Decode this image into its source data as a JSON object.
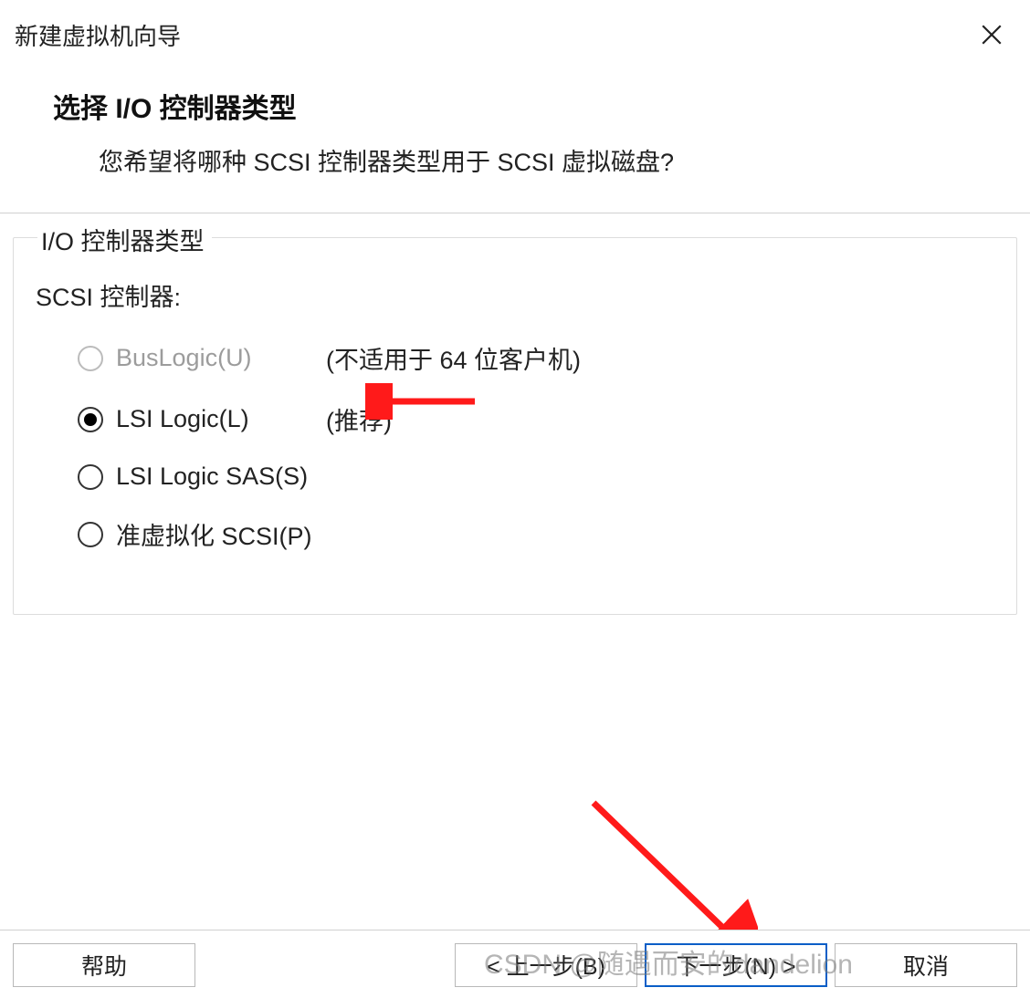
{
  "window": {
    "title": "新建虚拟机向导"
  },
  "header": {
    "title": "选择 I/O 控制器类型",
    "subtitle": "您希望将哪种 SCSI 控制器类型用于 SCSI 虚拟磁盘?"
  },
  "group": {
    "title": "I/O 控制器类型",
    "controller_label": "SCSI 控制器:",
    "options": [
      {
        "label": "BusLogic(U)",
        "note": "(不适用于 64 位客户机)",
        "disabled": true,
        "selected": false
      },
      {
        "label": "LSI Logic(L)",
        "note": "(推荐)",
        "disabled": false,
        "selected": true
      },
      {
        "label": "LSI Logic SAS(S)",
        "note": "",
        "disabled": false,
        "selected": false
      },
      {
        "label": "准虚拟化 SCSI(P)",
        "note": "",
        "disabled": false,
        "selected": false
      }
    ]
  },
  "buttons": {
    "help": "帮助",
    "back": "< 上一步(B)",
    "next": "下一步(N) >",
    "cancel": "取消"
  },
  "watermark": "CSDN @随遇而安的dandelion"
}
